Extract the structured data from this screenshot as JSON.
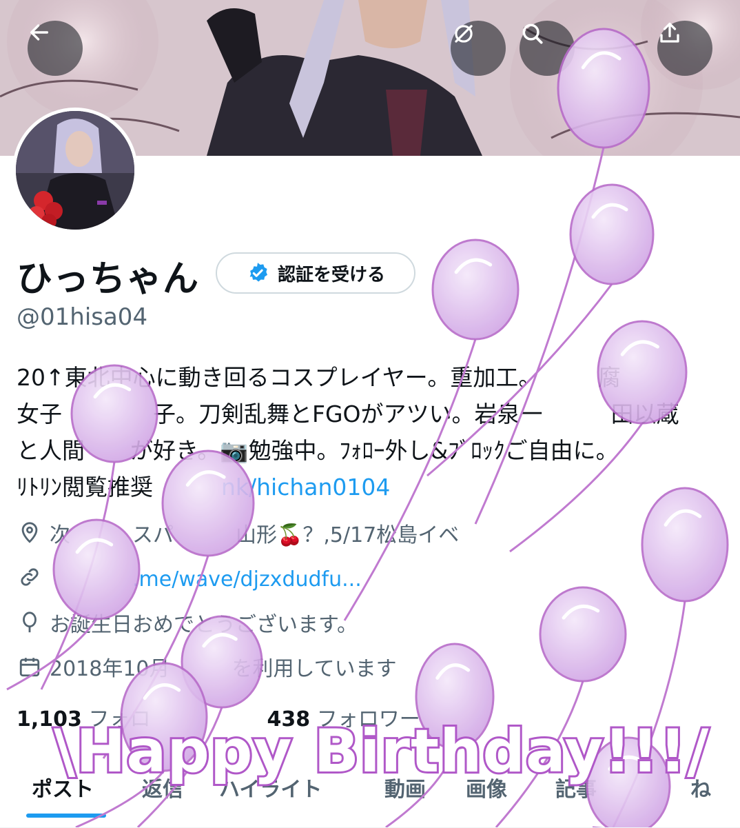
{
  "colors": {
    "accent": "#1d9bf0",
    "muted": "#536471",
    "balloon": "#d9b8ec",
    "balloon_outline": "#b76cc9"
  },
  "header": {
    "back_icon": "arrow-left-icon",
    "translate_icon": "eye-slash-icon",
    "search_icon": "search-icon",
    "share_icon": "share-icon"
  },
  "profile": {
    "name": "ひっちゃん",
    "verify_label": "認証を受ける",
    "verify_icon": "verified-badge-icon",
    "handle": "@01hisa04",
    "bio_lines": [
      "20↑東北中心に動き回るコスプレイヤー。重加工。　　　腐",
      "女子　　　　子。刀剣乱舞とFGOがアツい。岩泉一　　　田以蔵",
      "と人間　　が好き。📷勉強中。ﾌｫﾛｰ外し&ﾌﾞﾛｯｸご自由に。"
    ],
    "bio_last_prefix": "ﾘﾄﾘﾝ閲覧推奨",
    "bio_link": "　　　nk/hichan0104",
    "location": "次　　　スパ　　　山形🍒？,5/17松島イベ",
    "website": "　　　　.me/wave/djzxdudfu...",
    "birthday": "お誕生日おめでとうございます。",
    "joined": "2018年10月　　　を利用しています"
  },
  "stats": {
    "following_count": "1,103",
    "following_label": "フォロ",
    "followers_count": "438",
    "followers_label": "フォロワー"
  },
  "tabs": [
    "ポスト",
    "返信",
    "ハイライト",
    "動画",
    "画像",
    "記事",
    "ね"
  ],
  "overlay": {
    "text": "\\Happy Birthday!!!/"
  }
}
